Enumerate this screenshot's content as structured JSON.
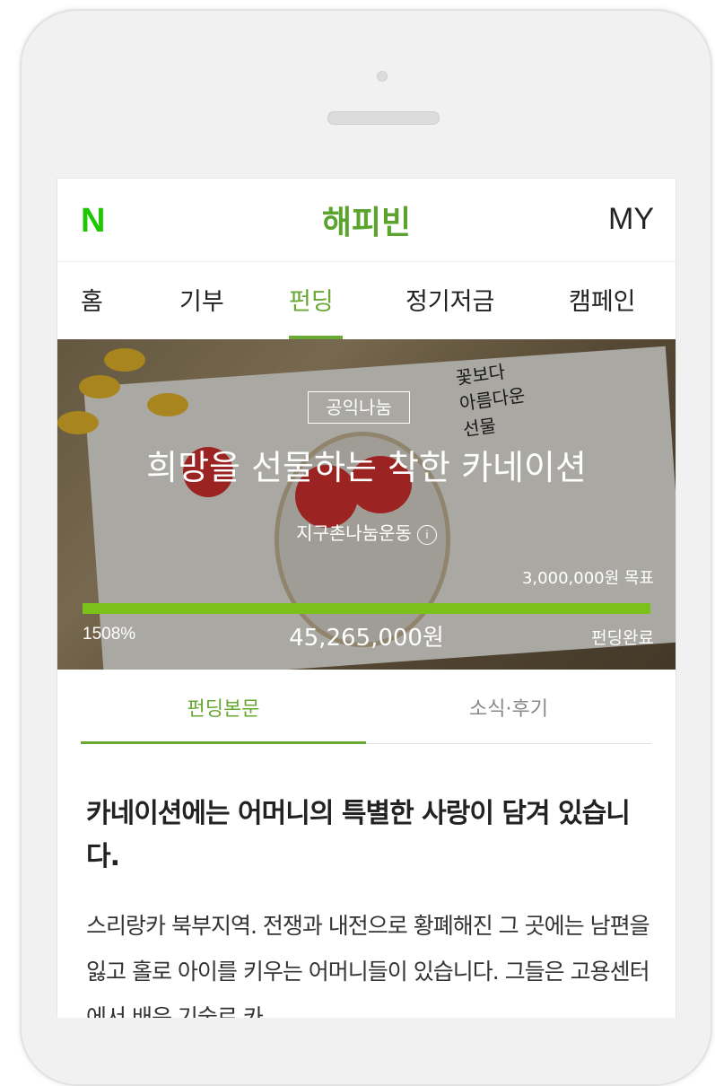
{
  "header": {
    "logo": "N",
    "brand": "해피빈",
    "my": "MY"
  },
  "nav": {
    "items": [
      "홈",
      "기부",
      "펀딩",
      "정기저금",
      "캠페인"
    ],
    "active_index": 2
  },
  "hero": {
    "tag": "공익나눔",
    "title": "희망을 선물하는 착한 카네이션",
    "organization": "지구촌나눔운동",
    "info_icon": "i",
    "goal": "3,000,000원 목표",
    "progress_percent": "1508%",
    "progress_fill_fraction": 1.0,
    "amount": "45,265,000원",
    "status": "펀딩완료",
    "card_text": [
      "꽃보다",
      "아름다운",
      "선물"
    ]
  },
  "content_tabs": {
    "items": [
      "펀딩본문",
      "소식·후기"
    ],
    "active_index": 0
  },
  "article": {
    "title": "카네이션에는 어머니의 특별한 사랑이 담겨 있습니다.",
    "body": "스리랑카 북부지역. 전쟁과 내전으로 황폐해진 그 곳에는 남편을 잃고 홀로 아이를 키우는 어머니들이 있습니다. 그들은 고용센터에서 배운 기술로 카"
  },
  "colors": {
    "accent": "#6aa835",
    "logo_green": "#1ec800",
    "progress": "#7bc11a"
  }
}
